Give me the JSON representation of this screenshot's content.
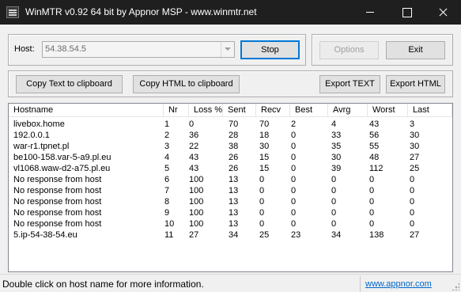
{
  "window": {
    "title": "WinMTR v0.92 64 bit by Appnor MSP - www.winmtr.net"
  },
  "host": {
    "label": "Host:",
    "value": "54.38.54.5"
  },
  "buttons": {
    "stop": "Stop",
    "options": "Options",
    "exit": "Exit",
    "copy_text": "Copy Text to clipboard",
    "copy_html": "Copy HTML to clipboard",
    "export_text": "Export TEXT",
    "export_html": "Export HTML"
  },
  "table": {
    "columns": [
      "Hostname",
      "Nr",
      "Loss %",
      "Sent",
      "Recv",
      "Best",
      "Avrg",
      "Worst",
      "Last"
    ],
    "rows": [
      [
        "livebox.home",
        "1",
        "0",
        "70",
        "70",
        "2",
        "4",
        "43",
        "3"
      ],
      [
        "192.0.0.1",
        "2",
        "36",
        "28",
        "18",
        "0",
        "33",
        "56",
        "30"
      ],
      [
        "war-r1.tpnet.pl",
        "3",
        "22",
        "38",
        "30",
        "0",
        "35",
        "55",
        "30"
      ],
      [
        "be100-158.var-5-a9.pl.eu",
        "4",
        "43",
        "26",
        "15",
        "0",
        "30",
        "48",
        "27"
      ],
      [
        "vl1068.waw-d2-a75.pl.eu",
        "5",
        "43",
        "26",
        "15",
        "0",
        "39",
        "112",
        "25"
      ],
      [
        "No response from host",
        "6",
        "100",
        "13",
        "0",
        "0",
        "0",
        "0",
        "0"
      ],
      [
        "No response from host",
        "7",
        "100",
        "13",
        "0",
        "0",
        "0",
        "0",
        "0"
      ],
      [
        "No response from host",
        "8",
        "100",
        "13",
        "0",
        "0",
        "0",
        "0",
        "0"
      ],
      [
        "No response from host",
        "9",
        "100",
        "13",
        "0",
        "0",
        "0",
        "0",
        "0"
      ],
      [
        "No response from host",
        "10",
        "100",
        "13",
        "0",
        "0",
        "0",
        "0",
        "0"
      ],
      [
        "5.ip-54-38-54.eu",
        "11",
        "27",
        "34",
        "25",
        "23",
        "34",
        "138",
        "27"
      ]
    ]
  },
  "status": {
    "message": "Double click on host name for more information.",
    "link": "www.appnor.com"
  }
}
